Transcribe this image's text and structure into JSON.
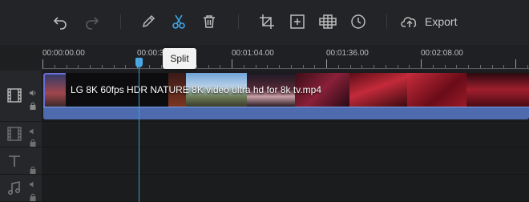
{
  "toolbar": {
    "export_label": "Export",
    "tooltip": "Split"
  },
  "ruler": {
    "labels": [
      "00:00:00.00",
      "00:00:32.00",
      "00:01:04.00",
      "00:01:36.00",
      "00:02:08.00"
    ]
  },
  "clip": {
    "title": "LG 8K 60fps HDR NATURE 8K video ultra hd for 8k tv.mp4"
  },
  "colors": {
    "playhead": "#3d9cd6",
    "audio_bar": "#4e6bb0",
    "clip_border": "#6a6dd8"
  }
}
